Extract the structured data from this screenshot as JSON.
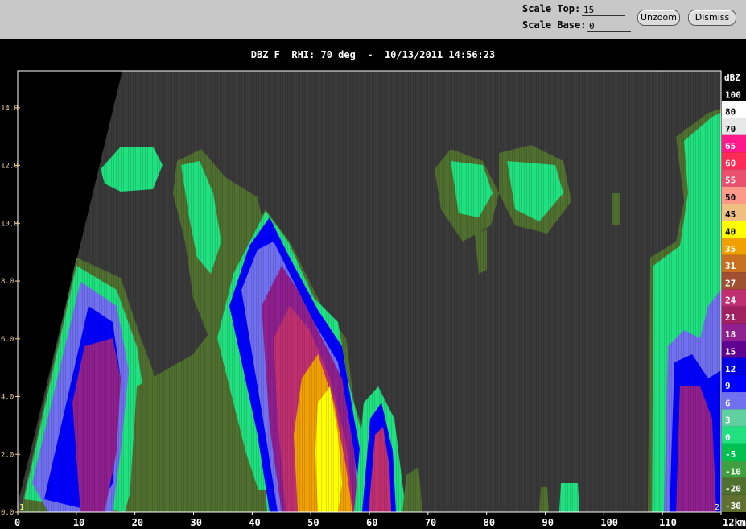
{
  "controls": {
    "scale_top_label": "Scale Top:",
    "scale_top_value": "15",
    "scale_base_label": "Scale Base:",
    "scale_base_value": "0",
    "unzoom_label": "Unzoom",
    "dismiss_label": "Dismiss"
  },
  "plot_title": "DBZ F  RHI: 70 deg  -  10/13/2011 14:56:23",
  "chart_data": {
    "type": "heatmap",
    "title": "DBZ F  RHI: 70 deg  -  10/13/2011 14:56:23",
    "x_ticks": [
      "0",
      "10",
      "20",
      "30",
      "40",
      "50",
      "60",
      "70",
      "80",
      "90",
      "100",
      "110",
      "12km"
    ],
    "y_ticks": [
      "0.0",
      "2.0",
      "4.0",
      "6.0",
      "8.0",
      "10.0",
      "12.0",
      "14.0"
    ],
    "xlim": [
      0,
      120
    ],
    "ylim": [
      0,
      15
    ],
    "corner_labels": [
      "1",
      "2"
    ],
    "colorbar": {
      "unit": "dBZ",
      "labels": [
        "100",
        "80",
        "70",
        "65",
        "60",
        "55",
        "50",
        "45",
        "40",
        "35",
        "31",
        "27",
        "24",
        "21",
        "18",
        "15",
        "12",
        "9",
        "6",
        "3",
        "0",
        "-5",
        "-10",
        "-20",
        "-30"
      ],
      "colors": [
        "#000000",
        "#ffffff",
        "#e8e8e8",
        "#ff1a8c",
        "#ff2a55",
        "#e8506e",
        "#ff9a8a",
        "#f0c080",
        "#ffff00",
        "#f0a000",
        "#c87020",
        "#a05030",
        "#c03070",
        "#a02060",
        "#902090",
        "#600090",
        "#0000e0",
        "#0000ff",
        "#7070f0",
        "#60d0a0",
        "#20e080",
        "#00c050",
        "#40a040",
        "#507030",
        "#607030"
      ]
    },
    "regions": [
      {
        "x": [
          0,
          18
        ],
        "y": [
          0,
          15
        ],
        "level": "no data (below beam)"
      },
      {
        "x": [
          1,
          20
        ],
        "y": [
          0,
          9
        ],
        "max_dbz": 21
      },
      {
        "x": [
          20,
          36
        ],
        "y": [
          0,
          12
        ],
        "max_dbz": 9
      },
      {
        "x": [
          30,
          63
        ],
        "y": [
          0,
          11
        ],
        "max_dbz": 45
      },
      {
        "x": [
          57,
          70
        ],
        "y": [
          0,
          4
        ],
        "max_dbz": 31
      },
      {
        "x": [
          70,
          108
        ],
        "y": [
          9.5,
          12.5
        ],
        "max_dbz": 0
      },
      {
        "x": [
          106,
          120
        ],
        "y": [
          0,
          13.5
        ],
        "max_dbz": 24
      }
    ]
  }
}
